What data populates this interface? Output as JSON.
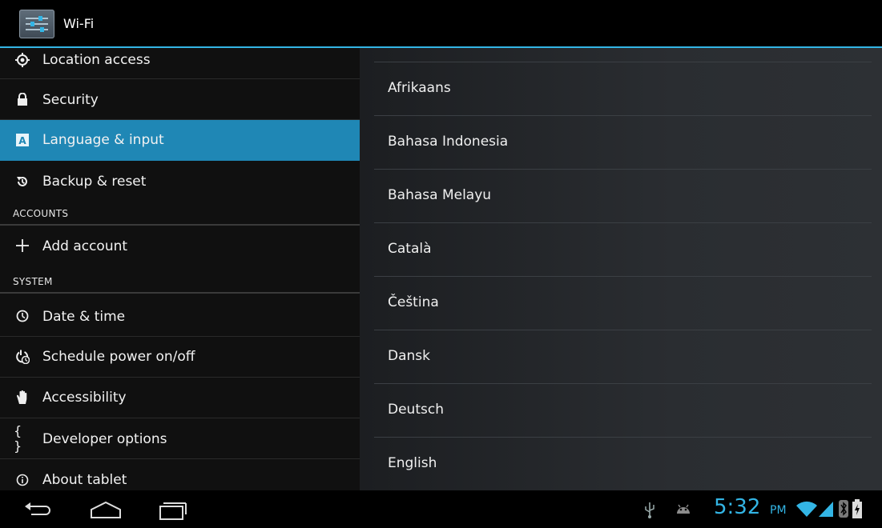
{
  "action_bar": {
    "title": "Wi-Fi",
    "icon": "settings-sliders-icon"
  },
  "settings_list": {
    "items": [
      {
        "label": "Location access",
        "icon": "location-icon"
      },
      {
        "label": "Security",
        "icon": "lock-icon"
      },
      {
        "label": "Language & input",
        "icon": "keyboard-a-icon",
        "selected": true
      },
      {
        "label": "Backup & reset",
        "icon": "backup-icon"
      }
    ],
    "accounts_header": "ACCOUNTS",
    "accounts_items": [
      {
        "label": "Add account",
        "icon": "plus-icon"
      }
    ],
    "system_header": "SYSTEM",
    "system_items": [
      {
        "label": "Date & time",
        "icon": "clock-icon"
      },
      {
        "label": "Schedule power on/off",
        "icon": "power-clock-icon"
      },
      {
        "label": "Accessibility",
        "icon": "hand-icon"
      },
      {
        "label": "Developer options",
        "icon": "braces-icon",
        "glyph": "{ }"
      },
      {
        "label": "About tablet",
        "icon": "info-icon"
      }
    ]
  },
  "languages": [
    "Afrikaans",
    "Bahasa Indonesia",
    "Bahasa Melayu",
    "Català",
    "Čeština",
    "Dansk",
    "Deutsch",
    "English"
  ],
  "status_bar": {
    "time": "5:32",
    "ampm": "PM",
    "icons": [
      "usb-icon",
      "android-debug-icon",
      "wifi-icon",
      "signal-icon",
      "bluetooth-icon",
      "battery-icon"
    ]
  },
  "nav": {
    "buttons": [
      "back-icon",
      "home-icon",
      "recent-apps-icon"
    ]
  },
  "colors": {
    "accent": "#33b5e5",
    "selected_row": "#1f87b5"
  }
}
